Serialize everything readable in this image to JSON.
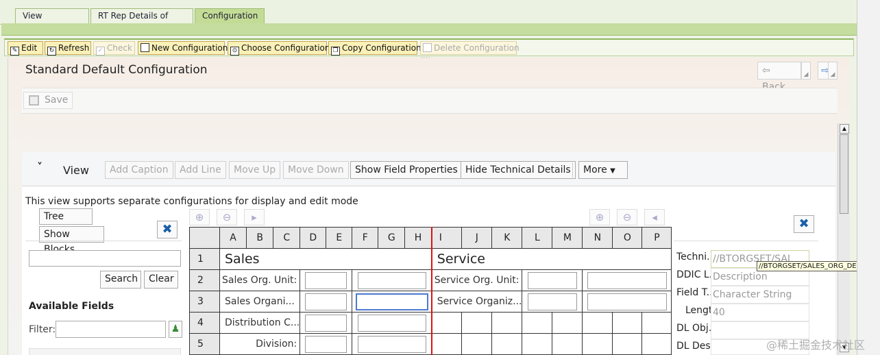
{
  "tabs": [
    "View Structure",
    "RT Rep Details of View",
    "Configuration"
  ],
  "toolbar": {
    "edit": "Edit",
    "refresh": "Refresh",
    "check": "Check",
    "new_config": "New Configuration",
    "choose_config": "Choose Configuration",
    "copy_config": "Copy Configuration",
    "delete_config": "Delete Configuration"
  },
  "config_title": "Standard Default Configuration",
  "nav": {
    "back": "Back"
  },
  "save_label": "Save",
  "view": {
    "label": "View",
    "add_caption": "Add Caption",
    "add_line": "Add Line",
    "move_up": "Move Up",
    "move_down": "Move Down",
    "show_field_props": "Show Field Properties",
    "hide_tech": "Hide Technical Details",
    "more": "More"
  },
  "description": "This view supports separate configurations for display and edit mode",
  "left_panel": {
    "tree_view": "Tree View",
    "show_blocks": "Show Blocks",
    "search": "Search",
    "clear": "Clear",
    "available_fields": "Available Fields",
    "filter_label": "Filter:"
  },
  "grid": {
    "columns": [
      "A",
      "B",
      "C",
      "D",
      "E",
      "F",
      "G",
      "H",
      "I",
      "J",
      "K",
      "L",
      "M",
      "N",
      "O",
      "P"
    ],
    "rows": [
      "1",
      "2",
      "3",
      "4",
      "5"
    ],
    "sales_header": "Sales",
    "service_header": "Service",
    "sales_labels": [
      "Sales Org. Unit:",
      "Sales Organi...",
      "Distribution C...",
      "Division:"
    ],
    "service_labels": [
      "Service Org. Unit:",
      "Service Organiz..."
    ]
  },
  "properties": [
    {
      "label": "Techni...",
      "value": "//BTORGSET/SAL"
    },
    {
      "label": "DDIC L...",
      "value": "Description"
    },
    {
      "label": "Field T...",
      "value": "Character String"
    },
    {
      "label": "Length:",
      "value": "40"
    },
    {
      "label": "DL Obj...",
      "value": ""
    },
    {
      "label": "DL Des...",
      "value": ""
    }
  ],
  "tooltip": "//BTORGSET/SALES_ORG_DESC",
  "watermark": "@稀土掘金技术社区"
}
